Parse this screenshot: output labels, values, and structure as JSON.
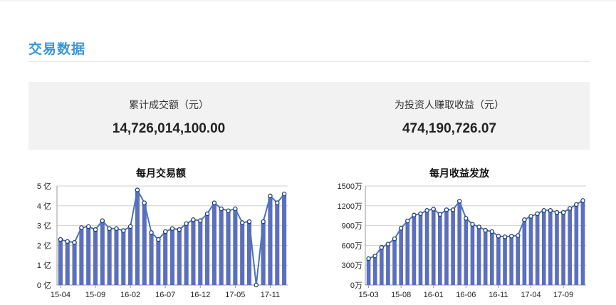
{
  "section": {
    "title": "交易数据"
  },
  "stats": [
    {
      "label": "累计成交额（元）",
      "value": "14,726,014,100.00"
    },
    {
      "label": "为投资人赚取收益（元）",
      "value": "474,190,726.07"
    }
  ],
  "colors": {
    "accent": "#3a95d8",
    "bar": "#5b6fbd",
    "line": "#4a73c0"
  },
  "chart_data": [
    {
      "type": "bar",
      "title": "每月交易额",
      "xlabel": "",
      "ylabel": "",
      "ylim": [
        0,
        5
      ],
      "y_ticks": [
        "0 亿",
        "1 亿",
        "2 亿",
        "3 亿",
        "4 亿",
        "5 亿"
      ],
      "x_tick_labels": [
        "15-04",
        "15-09",
        "16-02",
        "16-07",
        "16-12",
        "17-05",
        "17-11"
      ],
      "overlay_line": true,
      "grid": true,
      "series": [
        {
          "name": "",
          "values": [
            2.3,
            2.2,
            2.15,
            2.9,
            2.95,
            2.8,
            3.25,
            2.85,
            2.85,
            2.75,
            2.95,
            4.8,
            4.15,
            2.65,
            2.3,
            2.7,
            2.85,
            2.8,
            3.1,
            3.3,
            3.25,
            3.6,
            4.15,
            3.85,
            3.75,
            3.85,
            3.15,
            3.2,
            0.0,
            3.2,
            4.5,
            4.15,
            4.6
          ]
        }
      ]
    },
    {
      "type": "bar",
      "title": "每月收益发放",
      "xlabel": "",
      "ylabel": "",
      "ylim": [
        0,
        1500
      ],
      "y_ticks": [
        "0万",
        "300万",
        "600万",
        "900万",
        "1200万",
        "1500万"
      ],
      "x_tick_labels": [
        "15-03",
        "15-08",
        "16-01",
        "16-06",
        "16-11",
        "17-04",
        "17-09"
      ],
      "overlay_line": true,
      "grid": true,
      "series": [
        {
          "name": "",
          "values": [
            400,
            440,
            570,
            620,
            700,
            860,
            970,
            1060,
            1080,
            1130,
            1150,
            1070,
            1140,
            1140,
            1270,
            1010,
            920,
            880,
            830,
            810,
            740,
            730,
            740,
            750,
            990,
            1040,
            1080,
            1130,
            1130,
            1100,
            1100,
            1160,
            1220,
            1280
          ]
        }
      ]
    }
  ]
}
